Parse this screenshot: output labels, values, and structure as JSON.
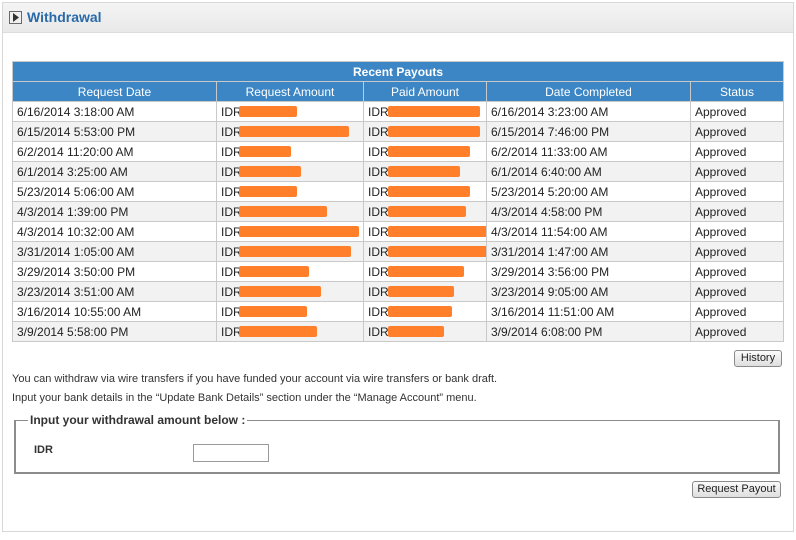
{
  "panel": {
    "title": "Withdrawal"
  },
  "table": {
    "caption": "Recent Payouts",
    "columns": [
      "Request Date",
      "Request Amount",
      "Paid Amount",
      "Date Completed",
      "Status"
    ],
    "rows": [
      {
        "request_date": "6/16/2014 3:18:00 AM",
        "request_amount": "IDR",
        "paid_amount": "IDR",
        "date_completed": "6/16/2014 3:23:00 AM",
        "status": "Approved"
      },
      {
        "request_date": "6/15/2014 5:53:00 PM",
        "request_amount": "IDR",
        "paid_amount": "IDR",
        "date_completed": "6/15/2014 7:46:00 PM",
        "status": "Approved"
      },
      {
        "request_date": "6/2/2014 11:20:00 AM",
        "request_amount": "IDR",
        "paid_amount": "IDR",
        "date_completed": "6/2/2014 11:33:00 AM",
        "status": "Approved"
      },
      {
        "request_date": "6/1/2014 3:25:00 AM",
        "request_amount": "IDR",
        "paid_amount": "IDR",
        "date_completed": "6/1/2014 6:40:00 AM",
        "status": "Approved"
      },
      {
        "request_date": "5/23/2014 5:06:00 AM",
        "request_amount": "IDR",
        "paid_amount": "IDR",
        "date_completed": "5/23/2014 5:20:00 AM",
        "status": "Approved"
      },
      {
        "request_date": "4/3/2014 1:39:00 PM",
        "request_amount": "IDR",
        "paid_amount": "IDR",
        "date_completed": "4/3/2014 4:58:00 PM",
        "status": "Approved"
      },
      {
        "request_date": "4/3/2014 10:32:00 AM",
        "request_amount": "IDR",
        "paid_amount": "IDR",
        "date_completed": "4/3/2014 11:54:00 AM",
        "status": "Approved"
      },
      {
        "request_date": "3/31/2014 1:05:00 AM",
        "request_amount": "IDR",
        "paid_amount": "IDR",
        "date_completed": "3/31/2014 1:47:00 AM",
        "status": "Approved"
      },
      {
        "request_date": "3/29/2014 3:50:00 PM",
        "request_amount": "IDR",
        "paid_amount": "IDR",
        "date_completed": "3/29/2014 3:56:00 PM",
        "status": "Approved"
      },
      {
        "request_date": "3/23/2014 3:51:00 AM",
        "request_amount": "IDR",
        "paid_amount": "IDR",
        "date_completed": "3/23/2014 9:05:00 AM",
        "status": "Approved"
      },
      {
        "request_date": "3/16/2014 10:55:00 AM",
        "request_amount": "IDR",
        "paid_amount": "IDR",
        "date_completed": "3/16/2014 11:51:00 AM",
        "status": "Approved"
      },
      {
        "request_date": "3/9/2014 5:58:00 PM",
        "request_amount": "IDR",
        "paid_amount": "IDR",
        "date_completed": "3/9/2014 6:08:00 PM",
        "status": "Approved"
      }
    ]
  },
  "buttons": {
    "history": "History",
    "request_payout": "Request Payout"
  },
  "info": {
    "line1": "You can withdraw via wire transfers if you have funded your account via wire transfers or bank draft.",
    "line2": "Input your bank details in the “Update Bank Details” section under the “Manage Account” menu."
  },
  "form": {
    "legend": "Input your withdrawal amount below :",
    "currency": "IDR",
    "amount_value": ""
  },
  "colors": {
    "header_blue": "#3c86c6",
    "title_blue": "#2a6aa8",
    "redaction": "#ff7f2a"
  },
  "icons": {
    "panel_toggle": "triangle-right-icon"
  }
}
